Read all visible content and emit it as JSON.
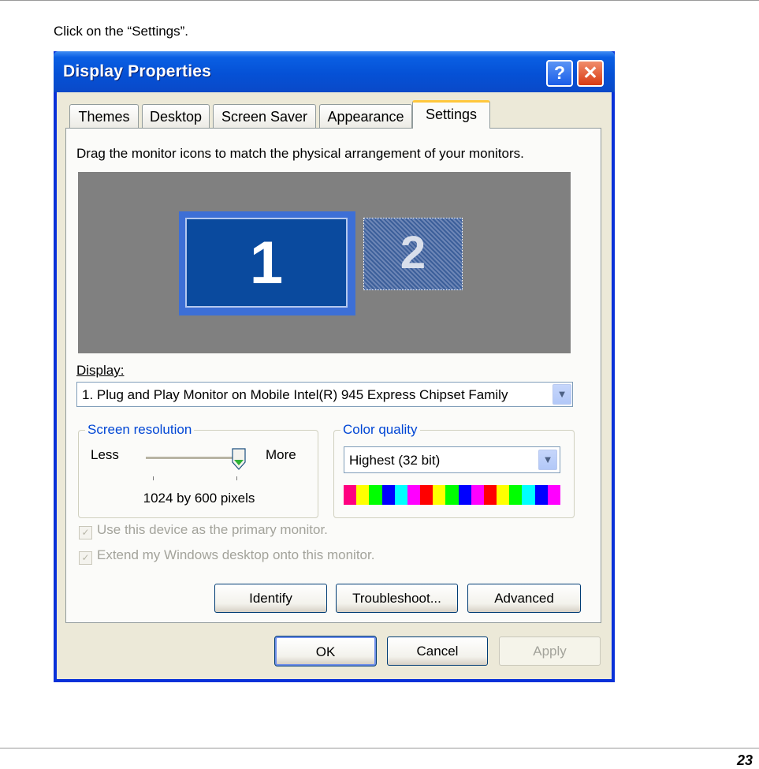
{
  "instruction": "Click on the “Settings”.",
  "page_number": "23",
  "window": {
    "title": "Display Properties",
    "help_glyph": "?",
    "close_glyph": "✕",
    "help_icon": "question-mark-icon",
    "close_icon": "close-x-icon"
  },
  "tabs": [
    {
      "label": "Themes",
      "active": false
    },
    {
      "label": "Desktop",
      "active": false
    },
    {
      "label": "Screen Saver",
      "active": false
    },
    {
      "label": "Appearance",
      "active": false
    },
    {
      "label": "Settings",
      "active": true
    }
  ],
  "settings": {
    "instructions": "Drag the monitor icons to match the physical arrangement of your monitors.",
    "monitors": [
      {
        "number": "1",
        "selected": true
      },
      {
        "number": "2",
        "selected": false
      }
    ],
    "display_label": "Display:",
    "display_value": "1. Plug and Play Monitor on Mobile Intel(R) 945 Express Chipset Family",
    "screen_resolution": {
      "title": "Screen resolution",
      "less": "Less",
      "more": "More",
      "value": "1024 by 600 pixels",
      "slider_position": 1.0
    },
    "color_quality": {
      "title": "Color quality",
      "value": "Highest (32 bit)",
      "bar_colors": [
        "#ff0080",
        "#ffff00",
        "#00ff00",
        "#0000ff",
        "#00ffff",
        "#ff00ff",
        "#ff0000",
        "#ffff00",
        "#00ff00",
        "#0000ff",
        "#ff00ff",
        "#ff0000",
        "#ffff00",
        "#00ff00",
        "#00ffff",
        "#0000ff",
        "#ff00ff"
      ]
    },
    "checkboxes": [
      {
        "label": "Use this device as the primary monitor.",
        "checked": true,
        "enabled": false
      },
      {
        "label": "Extend my Windows desktop onto this monitor.",
        "checked": true,
        "enabled": false
      }
    ],
    "buttons": {
      "identify": "Identify",
      "troubleshoot": "Troubleshoot...",
      "advanced": "Advanced"
    }
  },
  "dialog_buttons": {
    "ok": "OK",
    "cancel": "Cancel",
    "apply": "Apply"
  },
  "dropdown_icon": "chevron-down-icon",
  "check_glyph": "✓"
}
